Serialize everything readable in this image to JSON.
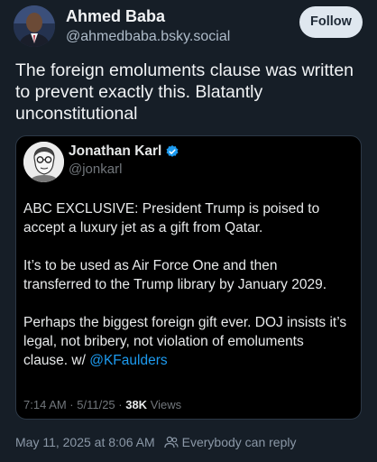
{
  "author": {
    "name": "Ahmed Baba",
    "handle": "@ahmedbaba.bsky.social",
    "avatar_icon": "profile-photo"
  },
  "follow_label": "Follow",
  "post_text": "The foreign emoluments clause was written to prevent exactly this. Blatantly unconstitutional",
  "embed": {
    "author_name": "Jonathan Karl",
    "author_handle": "@jonkarl",
    "verified_icon": "verified-badge-icon",
    "paragraphs": [
      "ABC EXCLUSIVE: President Trump is poised to accept a luxury jet as a gift from Qatar.",
      "It’s to be used as Air Force One and then transferred to the Trump library by January 2029.",
      "Perhaps the biggest foreign gift ever. DOJ insists it’s legal, not bribery, not violation of emoluments clause. w/ "
    ],
    "mention": "@KFaulders",
    "time_date": "7:14 AM · 5/11/25 · ",
    "views_count": "38K",
    "views_label": " Views",
    "link_color": "#1d9bf0"
  },
  "post_meta": {
    "timestamp": "May 11, 2025 at 8:06 AM",
    "reply_icon": "people-icon",
    "reply_setting": "Everybody can reply"
  },
  "colors": {
    "background": "#161e27",
    "embed_background": "#000000",
    "follow_button": "#dfe7ef"
  }
}
